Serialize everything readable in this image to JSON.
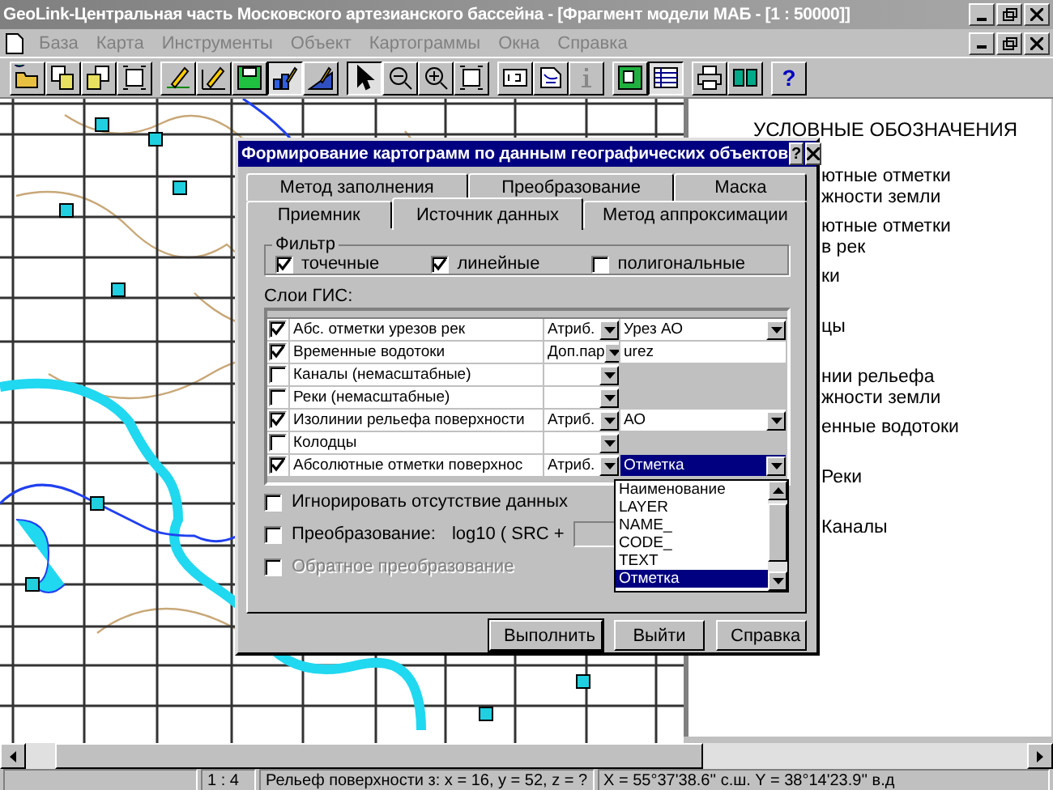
{
  "window": {
    "title": "GeoLink-Центральная часть Московского артезианского бассейна - [Фрагмент модели МАБ - [1 : 50000]]"
  },
  "menu": [
    "База",
    "Карта",
    "Инструменты",
    "Объект",
    "Картограммы",
    "Окна",
    "Справка"
  ],
  "toolbar": [
    [
      {
        "kind": "open",
        "pressed": false
      },
      {
        "kind": "copy",
        "pressed": false
      },
      {
        "kind": "swap",
        "pressed": false
      },
      {
        "kind": "frame",
        "pressed": false
      }
    ],
    [
      {
        "kind": "pen",
        "pressed": false
      },
      {
        "kind": "pen2",
        "pressed": false
      },
      {
        "kind": "floppy",
        "pressed": false
      },
      {
        "kind": "chart",
        "pressed": true
      },
      {
        "kind": "chart2",
        "pressed": false
      }
    ],
    [
      {
        "kind": "pointer",
        "pressed": true
      },
      {
        "kind": "zoom-out",
        "pressed": false
      },
      {
        "kind": "zoom-in",
        "pressed": false
      },
      {
        "kind": "frame",
        "pressed": false
      }
    ],
    [
      {
        "kind": "label",
        "pressed": false
      },
      {
        "kind": "text",
        "pressed": false
      },
      {
        "kind": "info",
        "pressed": false
      }
    ],
    [
      {
        "kind": "map",
        "pressed": false
      },
      {
        "kind": "table",
        "pressed": true
      }
    ],
    [
      {
        "kind": "printer",
        "pressed": false
      },
      {
        "kind": "grid",
        "pressed": false
      }
    ],
    [
      {
        "kind": "help",
        "pressed": false,
        "label": "?"
      }
    ]
  ],
  "legend": {
    "title": "УСЛОВНЫЕ ОБОЗНАЧЕНИЯ",
    "items": [
      {
        "lines": [
          "ютные  отметки",
          "жности    земли"
        ]
      },
      {
        "lines": [
          "ютные  отметки",
          "в   рек"
        ]
      },
      {
        "lines": [
          "ки"
        ]
      },
      {
        "lines": [
          "цы"
        ]
      },
      {
        "lines": [
          "нии   рельефа",
          "жности  земли"
        ]
      },
      {
        "lines": [
          "енные водотоки"
        ]
      },
      {
        "lines": [
          "Реки"
        ]
      },
      {
        "lines": [
          "Каналы"
        ]
      }
    ]
  },
  "dialog": {
    "title": "Формирование картограмм по данным географических объектов",
    "help": "?",
    "tab_rows": [
      [
        {
          "label": "Метод заполнения",
          "selected": false
        },
        {
          "label": "Преобразование",
          "selected": false
        },
        {
          "label": "Маска",
          "selected": false
        }
      ],
      [
        {
          "label": "Приемник",
          "selected": false
        },
        {
          "label": "Источник данных",
          "selected": true
        },
        {
          "label": "Метод аппроксимации",
          "selected": false
        }
      ]
    ],
    "filter": {
      "label": "Фильтр",
      "options": [
        {
          "label": "точечные",
          "checked": true
        },
        {
          "label": "линейные",
          "checked": true
        },
        {
          "label": "полигональные",
          "checked": false
        }
      ]
    },
    "layers_label": "Слои ГИС:",
    "layers": [
      {
        "checked": true,
        "name": "Абс. отметки урезов рек",
        "attr": "Атриб.",
        "value": "Урез АО",
        "dropdown": true,
        "disabled": false,
        "selected": false
      },
      {
        "checked": true,
        "name": "Временные водотоки",
        "attr": "Доп.пар",
        "value": "urez",
        "dropdown": false,
        "disabled": false,
        "selected": false
      },
      {
        "checked": false,
        "name": "Каналы (немасштабные)",
        "dropdown": false,
        "disabled": true,
        "selected": false
      },
      {
        "checked": false,
        "name": "Реки (немасштабные)",
        "dropdown": false,
        "disabled": true,
        "selected": false
      },
      {
        "checked": true,
        "name": "Изолинии рельефа поверхности",
        "attr": "Атриб.",
        "value": "АО",
        "dropdown": true,
        "disabled": false,
        "selected": false
      },
      {
        "checked": false,
        "name": "Колодцы",
        "dropdown": false,
        "disabled": true,
        "selected": false
      },
      {
        "checked": true,
        "name": "Абсолютные отметки поверхнос",
        "attr": "Атриб.",
        "value": "Отметка",
        "dropdown": true,
        "disabled": false,
        "selected": true
      }
    ],
    "dropdown": [
      {
        "label": "Наименование",
        "selected": false
      },
      {
        "label": "LAYER",
        "selected": false
      },
      {
        "label": "NAME_",
        "selected": false
      },
      {
        "label": "CODE_",
        "selected": false
      },
      {
        "label": "TEXT",
        "selected": false
      },
      {
        "label": "Отметка",
        "selected": true
      }
    ],
    "ignore": {
      "label": "Игнорировать отсутствие данных",
      "checked": false
    },
    "transform": {
      "label": "Преобразование:",
      "checked": false,
      "formula": "log10 ( SRC +"
    },
    "inverse": {
      "label": "Обратное преобразование",
      "checked": false,
      "disabled": true
    },
    "buttons": [
      "Выполнить",
      "Выйти",
      "Справка"
    ]
  },
  "status_bar": [
    "1 : 4",
    "Рельеф поверхности з: x = 16, y = 52, z = ?",
    "X = 55°37'38.6'' с.ш.  Y = 38°14'23.9'' в.д"
  ]
}
